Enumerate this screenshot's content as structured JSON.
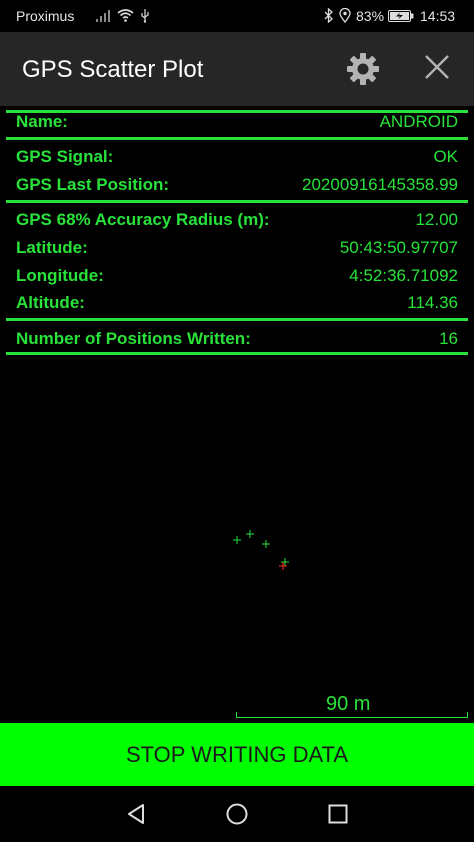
{
  "status_bar": {
    "carrier": "Proximus",
    "battery": "83%",
    "time": "14:53",
    "icons": [
      "signal-icon",
      "wifi-icon",
      "usb-icon",
      "bluetooth-icon",
      "location-icon",
      "battery-charging-icon"
    ]
  },
  "header": {
    "title": "GPS Scatter Plot",
    "icons": [
      "gear-icon",
      "close-icon"
    ]
  },
  "info": {
    "name_label": "Name:",
    "name_value": "ANDROID",
    "signal_label": "GPS Signal:",
    "signal_value": "OK",
    "last_pos_label": "GPS Last Position:",
    "last_pos_value": "20200916145358.99",
    "accuracy_label": "GPS 68% Accuracy Radius (m):",
    "accuracy_value": "12.00",
    "lat_label": "Latitude:",
    "lat_value": "50:43:50.97707",
    "lon_label": "Longitude:",
    "lon_value": "4:52:36.71092",
    "alt_label": "Altitude:",
    "alt_value": "114.36",
    "written_label": "Number of Positions Written:",
    "written_value": "16"
  },
  "plot": {
    "scale_label": "90 m",
    "colors": {
      "point": "#28e23a",
      "current": "#ff3030"
    }
  },
  "actions": {
    "stop_label": "STOP WRITING DATA"
  },
  "navigation": {
    "icons": [
      "back-icon",
      "home-icon",
      "recents-icon"
    ]
  },
  "colors": {
    "accent": "#28e23a",
    "button": "#00ff00",
    "header_bg": "#262626"
  }
}
